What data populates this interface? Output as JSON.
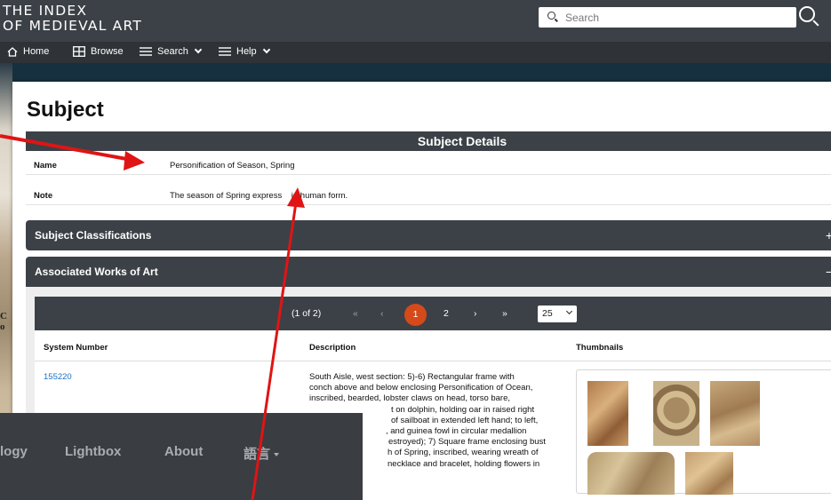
{
  "header": {
    "logo_line1": "THE INDEX",
    "logo_line2": "OF MEDIEVAL ART",
    "search_placeholder": "Search"
  },
  "nav": {
    "items": [
      {
        "label": "Home",
        "icon": "home-icon"
      },
      {
        "label": "Browse",
        "icon": "grid-icon"
      },
      {
        "label": "Search",
        "icon": "menu-icon"
      },
      {
        "label": "Help",
        "icon": "menu-icon"
      }
    ]
  },
  "background": {
    "partial_text": "C\no"
  },
  "page": {
    "title": "Subject",
    "details_heading": "Subject Details",
    "name_label": "Name",
    "name_value": "Personification of Season, Spring",
    "note_label": "Note",
    "note_value": "The season of Spring express    in human form."
  },
  "sections": {
    "classifications": {
      "label": "Subject Classifications",
      "toggle": "+"
    },
    "works": {
      "label": "Associated Works of Art",
      "toggle": "−"
    }
  },
  "pager": {
    "summary": "(1 of 2)",
    "first": "«",
    "prev": "‹",
    "current": "1",
    "next_page": "2",
    "next": "›",
    "last": "»",
    "per_page": "25"
  },
  "table": {
    "headers": [
      "System Number",
      "Description",
      "Thumbnails"
    ],
    "rows": [
      {
        "system_number": "155220",
        "description_lines": [
          "South Aisle, west section: 5)-6) Rectangular frame with",
          "conch above and below enclosing Personification of Ocean,",
          "inscribed, bearded, lobster claws on head, torso bare,",
          "t on dolphin, holding oar in raised right",
          "of sailboat in extended left hand; to left,",
          ", and guinea fowl in circular medallion",
          "estroyed); 7) Square frame enclosing bust",
          "h of Spring, inscribed, wearing wreath of",
          "necklace and bracelet, holding flowers in"
        ]
      }
    ]
  },
  "overlay": {
    "items": [
      "logy",
      "Lightbox",
      "About",
      "語言"
    ]
  },
  "colors": {
    "header_bg": "#3b4147",
    "nav_bg": "#2f3337",
    "section_bg": "#3c4147",
    "page_current": "#d54a1a",
    "link": "#1a6fc4",
    "annotation_arrow": "#e01414"
  }
}
